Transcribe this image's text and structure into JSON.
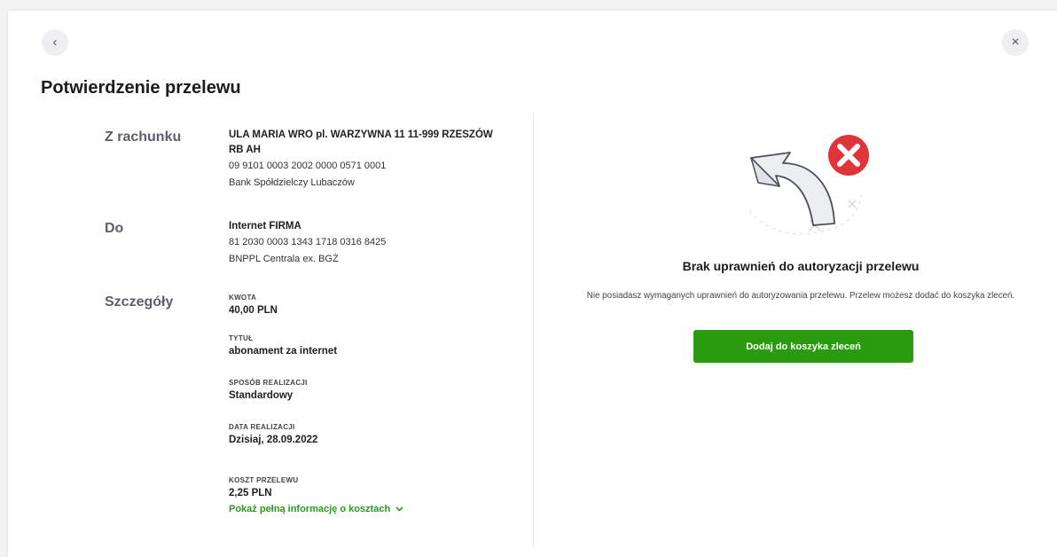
{
  "header": {
    "back_icon": "‹",
    "close_icon": "×",
    "title": "Potwierdzenie przelewu"
  },
  "from": {
    "label": "Z rachunku",
    "name_line1": "ULA MARIA WRO pl. WARZYWNA 11 11-999 RZESZÓW",
    "name_line2": "RB AH",
    "account": "09 9101 0003 2002 0000 0571 0001",
    "bank": "Bank Spółdzielczy Lubaczów"
  },
  "to": {
    "label": "Do",
    "name": "Internet FIRMA",
    "account": "81 2030 0003 1343 1718 0316 8425",
    "bank": "BNPPL Centrala ex. BGŻ"
  },
  "details": {
    "label": "Szczegóły",
    "amount_label": "KWOTA",
    "amount": "40,00 PLN",
    "title_label": "TYTUŁ",
    "title": "abonament za internet",
    "mode_label": "SPOSÓB REALIZACJI",
    "mode": "Standardowy",
    "date_label": "DATA REALIZACJI",
    "date": "Dzisiaj, 28.09.2022",
    "cost_label": "KOSZT PRZELEWU",
    "cost": "2,25 PLN",
    "cost_link": "Pokaż pełną informację o kosztach"
  },
  "message": {
    "title": "Brak uprawnień do autoryzacji przelewu",
    "body": "Nie posiadasz wymaganych uprawnień do autoryzowania przelewu. Przelew możesz dodać do koszyka zleceń.",
    "button_label": "Dodaj do koszyka zleceń"
  },
  "colors": {
    "accent_green": "#2a9a0f",
    "error_red": "#e0343b"
  }
}
